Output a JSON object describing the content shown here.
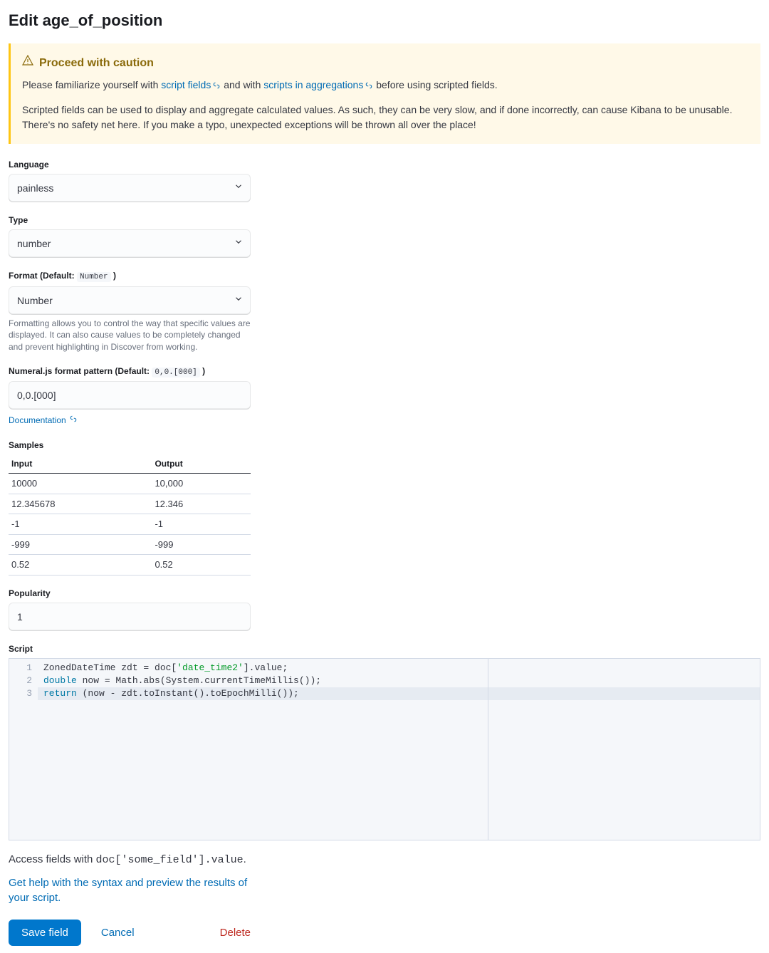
{
  "page": {
    "title": "Edit age_of_position"
  },
  "callout": {
    "title": "Proceed with caution",
    "text_before_link1": "Please familiarize yourself with ",
    "link1": "script fields",
    "text_between": " and with ",
    "link2": "scripts in aggregations",
    "text_after": " before using scripted fields.",
    "para2": "Scripted fields can be used to display and aggregate calculated values. As such, they can be very slow, and if done incorrectly, can cause Kibana to be unusable. There's no safety net here. If you make a typo, unexpected exceptions will be thrown all over the place!"
  },
  "language": {
    "label": "Language",
    "value": "painless"
  },
  "type": {
    "label": "Type",
    "value": "number"
  },
  "format": {
    "label_prefix": "Format (Default: ",
    "label_default": "Number",
    "label_suffix": " )",
    "value": "Number",
    "help": "Formatting allows you to control the way that specific values are displayed. It can also cause values to be completely changed and prevent highlighting in Discover from working."
  },
  "numeral": {
    "label_prefix": "Numeral.js format pattern (Default: ",
    "label_default": "0,0.[000]",
    "label_suffix": " )",
    "value": "0,0.[000]",
    "doc_link": "Documentation"
  },
  "samples": {
    "label": "Samples",
    "headers": {
      "input": "Input",
      "output": "Output"
    },
    "rows": [
      {
        "input": "10000",
        "output": "10,000"
      },
      {
        "input": "12.345678",
        "output": "12.346"
      },
      {
        "input": "-1",
        "output": "-1"
      },
      {
        "input": "-999",
        "output": "-999"
      },
      {
        "input": "0.52",
        "output": "0.52"
      }
    ]
  },
  "popularity": {
    "label": "Popularity",
    "value": "1"
  },
  "script": {
    "label": "Script",
    "lines": {
      "l1": {
        "n": "1",
        "a": "ZonedDateTime zdt = doc[",
        "b": "'date_time2'",
        "c": "].value;"
      },
      "l2": {
        "n": "2",
        "a": "double",
        "b": " now = Math.abs(System.currentTimeMillis());"
      },
      "l3": {
        "n": "3",
        "a": "return",
        "b": " (now - zdt.toInstant().toEpochMilli());"
      }
    }
  },
  "hint": {
    "before": "Access fields with ",
    "code": "doc['some_field'].value",
    "after": "."
  },
  "help_link": "Get help with the syntax and preview the results of your script.",
  "buttons": {
    "save": "Save field",
    "cancel": "Cancel",
    "delete": "Delete"
  }
}
